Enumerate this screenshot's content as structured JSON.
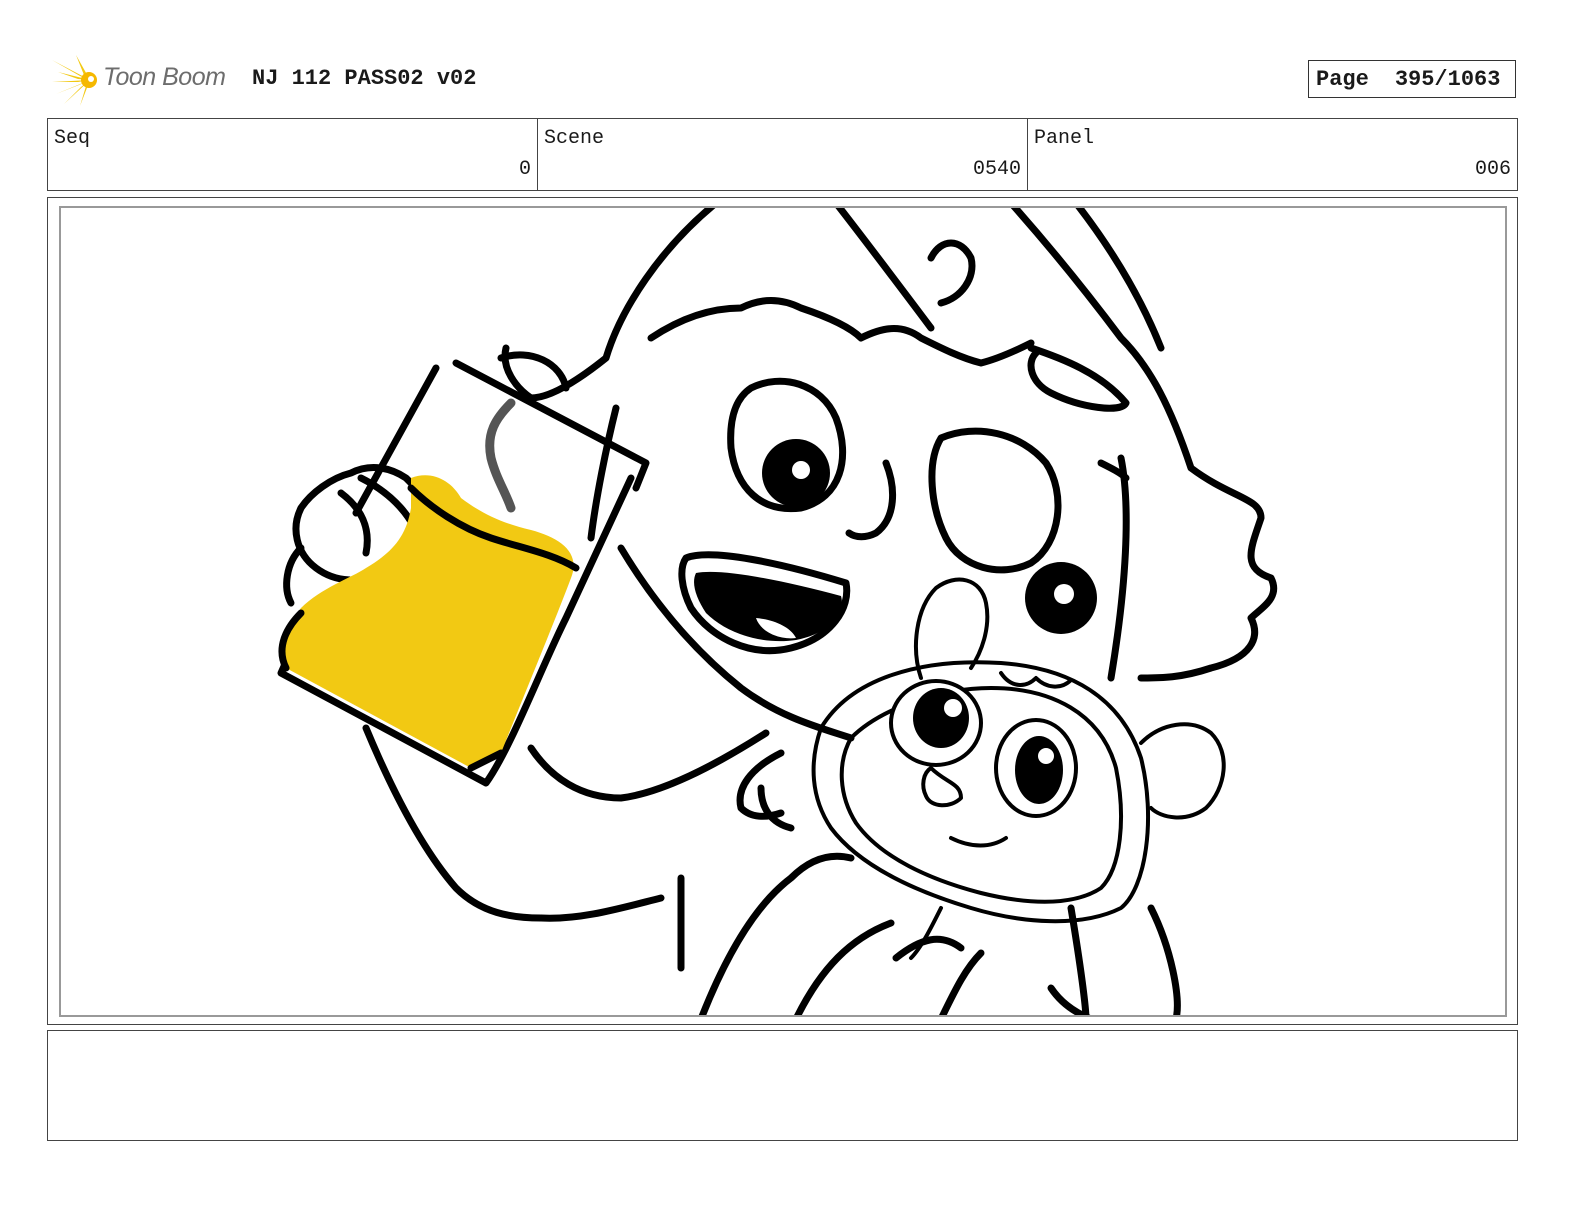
{
  "header": {
    "logo_text": "Toon Boom",
    "project_title": "NJ 112 PASS02 v02",
    "page_label": "Page",
    "page_number": "395/1063"
  },
  "info": {
    "seq_label": "Seq",
    "seq_value": "0",
    "scene_label": "Scene",
    "scene_value": "0540",
    "panel_label": "Panel",
    "panel_value": "006"
  },
  "colors": {
    "accent_yellow": "#F2C913",
    "ink": "#000000"
  },
  "icons": {
    "logo": "toon-boom-starburst-icon"
  },
  "notes": {
    "text": ""
  }
}
